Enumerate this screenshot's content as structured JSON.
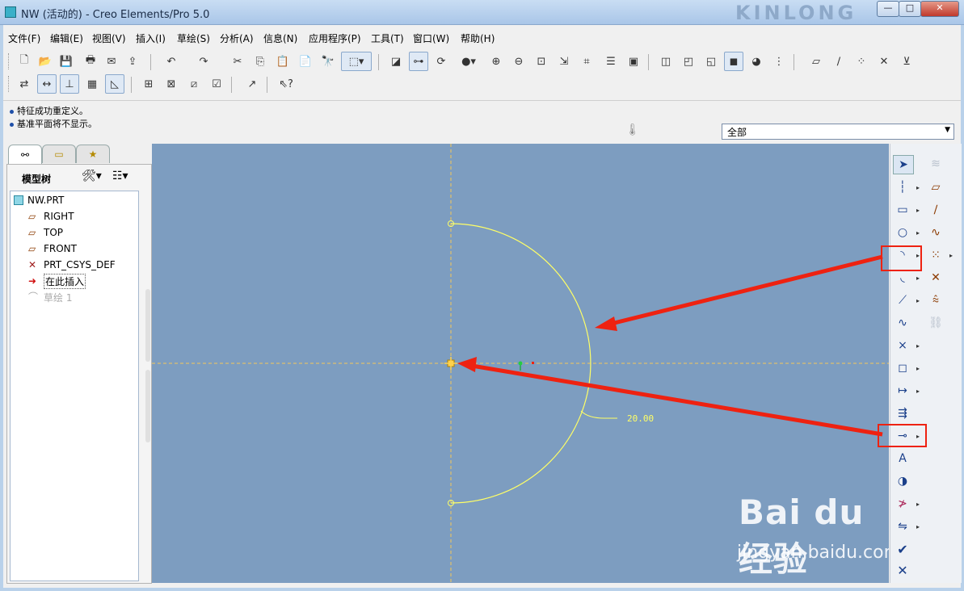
{
  "window": {
    "title": "NW (活动的) - Creo Elements/Pro 5.0",
    "banner_text": "KINLONG",
    "btn_min": "—",
    "btn_max": "□",
    "btn_close": "✕"
  },
  "menu": [
    "文件(F)",
    "编辑(E)",
    "视图(V)",
    "插入(I)",
    "草绘(S)",
    "分析(A)",
    "信息(N)",
    "应用程序(P)",
    "工具(T)",
    "窗口(W)",
    "帮助(H)"
  ],
  "messages": [
    "特征成功重定义。",
    "基准平面将不显示。"
  ],
  "filter": {
    "selected": "全部"
  },
  "model_tree": {
    "title": "模型树",
    "items": [
      {
        "label": "NW.PRT",
        "icon": "part-icon"
      },
      {
        "label": "RIGHT",
        "icon": "datum-plane-icon"
      },
      {
        "label": "TOP",
        "icon": "datum-plane-icon"
      },
      {
        "label": "FRONT",
        "icon": "datum-plane-icon"
      },
      {
        "label": "PRT_CSYS_DEF",
        "icon": "csys-icon"
      },
      {
        "label": "在此插入",
        "icon": "insert-arrow-icon"
      },
      {
        "label": "草绘 1",
        "icon": "sketch-icon"
      }
    ]
  },
  "sketch": {
    "dimension": "20.00",
    "arc_type": "semicircle",
    "radius_units": 20.0
  },
  "colors": {
    "canvas": "#7d9dc0",
    "sketch": "#ffff66",
    "annotation": "#ee2211",
    "centerline": "#f2c85a"
  },
  "watermark": {
    "logo": "Bai du 经验",
    "url": "jingyan.baidu.com"
  }
}
